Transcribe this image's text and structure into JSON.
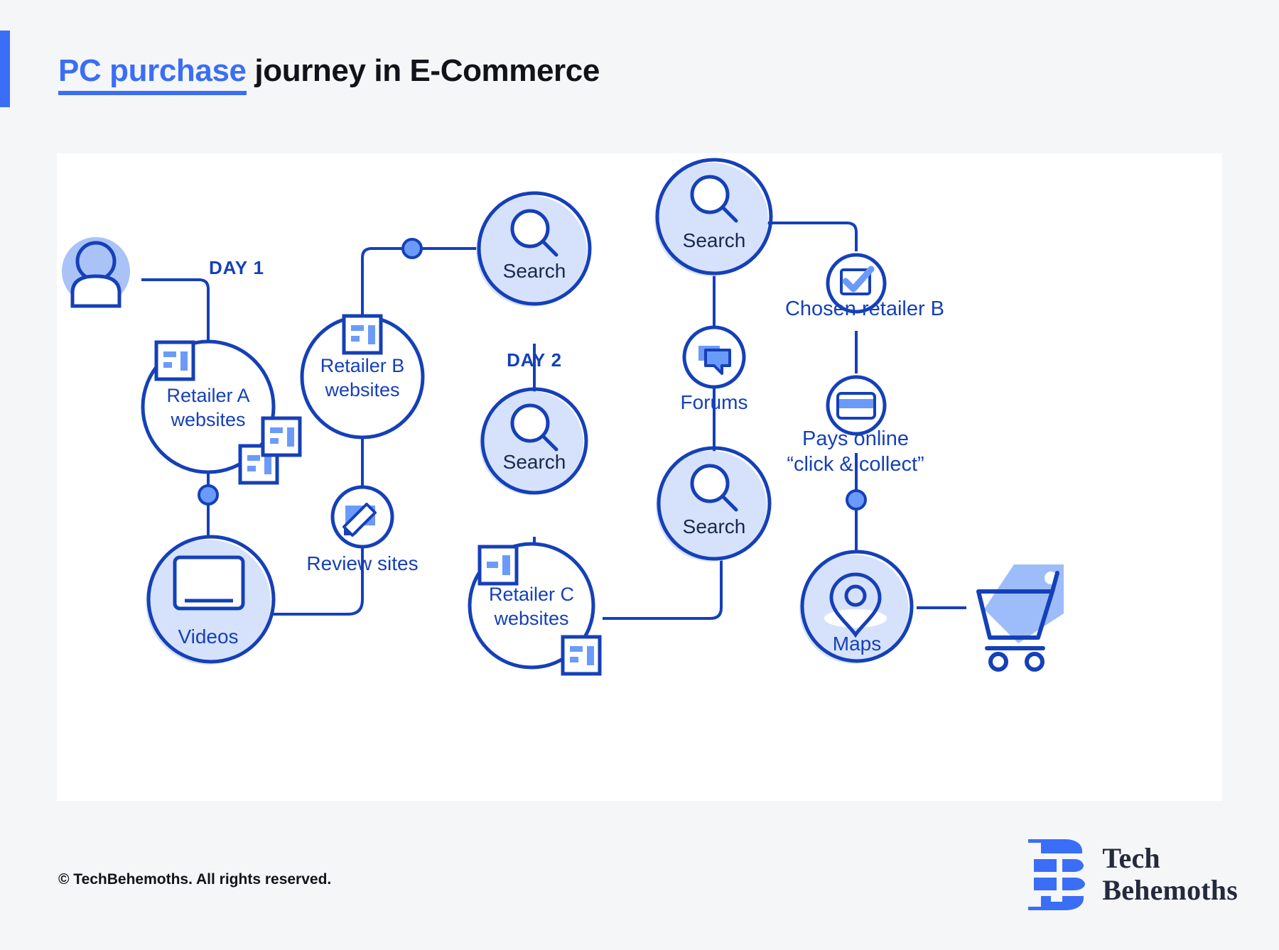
{
  "page": {
    "background_color": "#f5f6f7",
    "accent_color": "#3b6ef6",
    "stroke_color": "#1540b8",
    "fill_color": "#d6e2fb"
  },
  "header": {
    "title_highlight": "PC purchase",
    "title_rest": " journey in E-Commerce"
  },
  "diagram": {
    "day_labels": [
      {
        "id": "day-1",
        "text": "DAY 1"
      },
      {
        "id": "day-2",
        "text": "DAY 2"
      }
    ],
    "nodes": [
      {
        "id": "user",
        "label": "",
        "icon": "user-avatar-icon"
      },
      {
        "id": "retailer-a",
        "label_line1": "Retailer A",
        "label_line2": "websites",
        "icon": "browser-window-icon"
      },
      {
        "id": "videos",
        "label": "Videos",
        "icon": "video-play-icon"
      },
      {
        "id": "retailer-b",
        "label_line1": "Retailer B",
        "label_line2": "websites",
        "icon": "browser-window-icon"
      },
      {
        "id": "review-sites",
        "label": "Review sites",
        "icon": "pencil-review-icon"
      },
      {
        "id": "search-1",
        "label": "Search",
        "icon": "magnifier-icon"
      },
      {
        "id": "search-2",
        "label": "Search",
        "icon": "magnifier-icon"
      },
      {
        "id": "retailer-c",
        "label_line1": "Retailer C",
        "label_line2": "websites",
        "icon": "browser-window-icon"
      },
      {
        "id": "search-3",
        "label": "Search",
        "icon": "magnifier-icon"
      },
      {
        "id": "forums",
        "label": "Forums",
        "icon": "chat-bubbles-icon"
      },
      {
        "id": "search-4",
        "label": "Search",
        "icon": "magnifier-icon"
      },
      {
        "id": "chosen-retailer",
        "label": "Chosen retailer B",
        "icon": "checkbox-checked-icon"
      },
      {
        "id": "pays-online",
        "label_line1": "Pays online",
        "label_line2": "“click & collect”",
        "icon": "credit-card-icon"
      },
      {
        "id": "maps",
        "label": "Maps",
        "icon": "map-pin-icon"
      },
      {
        "id": "cart",
        "label": "",
        "icon": "shopping-cart-tag-icon"
      }
    ]
  },
  "footer": {
    "copyright": "© TechBehemoths. All rights reserved."
  },
  "logo": {
    "line1": "Tech",
    "line2": "Behemoths"
  }
}
